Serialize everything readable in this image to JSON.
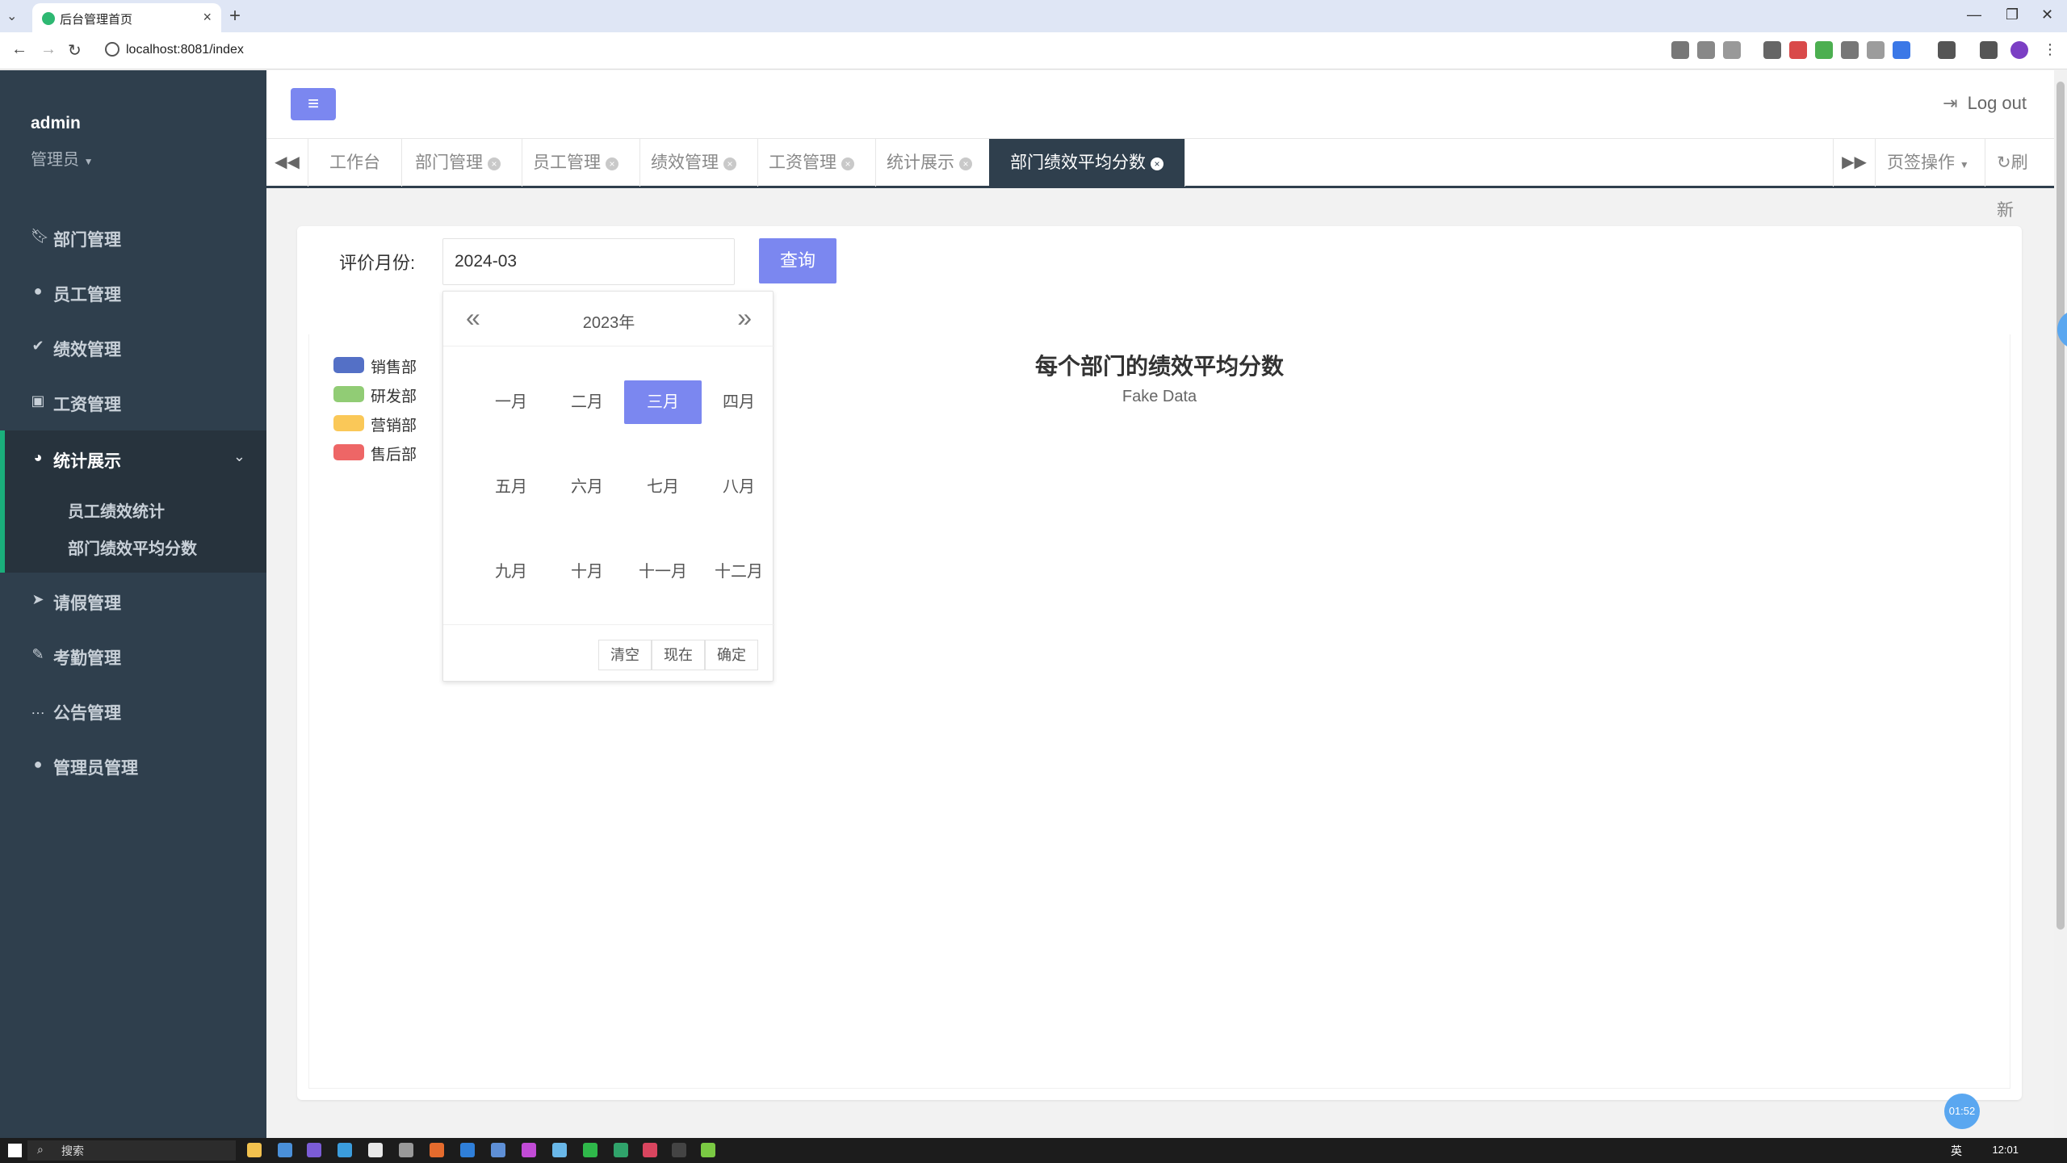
{
  "browser": {
    "tab_title": "后台管理首页",
    "url": "localhost:8081/index"
  },
  "sidebar": {
    "user_name": "admin",
    "user_role": "管理员",
    "items": [
      {
        "label": "部门管理",
        "icon": "bookmark-icon"
      },
      {
        "label": "员工管理",
        "icon": "user-circle-icon"
      },
      {
        "label": "绩效管理",
        "icon": "check-circle-icon"
      },
      {
        "label": "工资管理",
        "icon": "money-icon"
      },
      {
        "label": "统计展示",
        "icon": "pie-chart-icon"
      },
      {
        "label": "请假管理",
        "icon": "send-icon"
      },
      {
        "label": "考勤管理",
        "icon": "edit-icon"
      },
      {
        "label": "公告管理",
        "icon": "comment-icon"
      },
      {
        "label": "管理员管理",
        "icon": "user-circle-icon"
      }
    ],
    "submenu": [
      "员工绩效统计",
      "部门绩效平均分数"
    ]
  },
  "header": {
    "logout_label": "Log out"
  },
  "page_tabs": {
    "items": [
      "工作台",
      "部门管理",
      "员工管理",
      "绩效管理",
      "工资管理",
      "统计展示",
      "部门绩效平均分数"
    ],
    "active_index": 6,
    "tab_ops_label": "页签操作",
    "refresh_label": "刷新"
  },
  "form": {
    "label": "评价月份:",
    "month_value": "2024-03",
    "query_label": "查询"
  },
  "chart": {
    "title": "每个部门的绩效平均分数",
    "subtitle": "Fake Data",
    "legend": [
      {
        "name": "销售部",
        "color": "#5470c6"
      },
      {
        "name": "研发部",
        "color": "#91cc75"
      },
      {
        "name": "营销部",
        "color": "#fac858"
      },
      {
        "name": "售后部",
        "color": "#ee6666"
      }
    ]
  },
  "chart_data": {
    "type": "bar",
    "title": "每个部门的绩效平均分数",
    "subtitle": "Fake Data",
    "series": [
      {
        "name": "销售部",
        "values": []
      },
      {
        "name": "研发部",
        "values": []
      },
      {
        "name": "营销部",
        "values": []
      },
      {
        "name": "售后部",
        "values": []
      }
    ],
    "legend_position": "left"
  },
  "datepicker": {
    "year": "2023年",
    "months": [
      "一月",
      "二月",
      "三月",
      "四月",
      "五月",
      "六月",
      "七月",
      "八月",
      "九月",
      "十月",
      "十一月",
      "十二月"
    ],
    "selected_month": "三月",
    "clear_label": "清空",
    "now_label": "现在",
    "confirm_label": "确定"
  },
  "misc": {
    "float_badge": "01:52"
  },
  "taskbar": {
    "search_label": "搜索",
    "ime": "英",
    "time": "12:01"
  },
  "colors": {
    "sidebar_bg": "#2f3f4d",
    "accent": "#7b87f0",
    "active_marker": "#1aaf7b"
  }
}
